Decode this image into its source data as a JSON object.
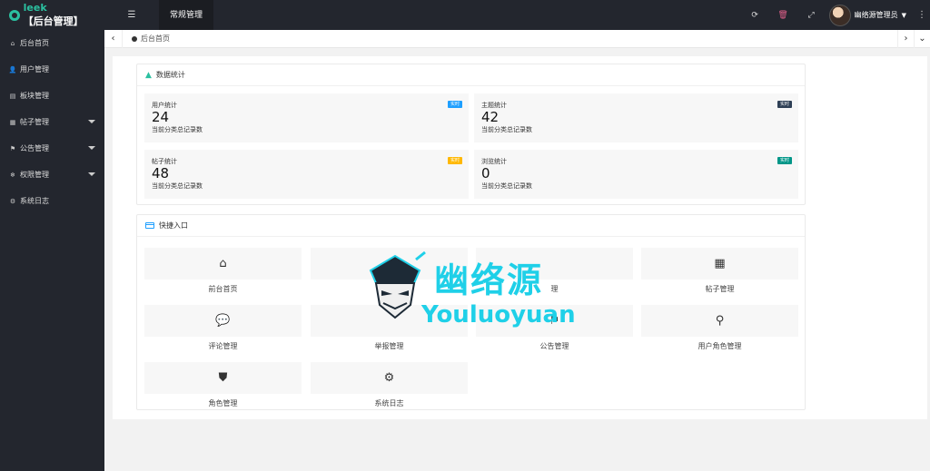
{
  "header": {
    "logo_text": "leek",
    "logo_sub": "【后台管理】",
    "tab": "常规管理",
    "user_name": "幽络源管理员"
  },
  "sidebar": {
    "items": [
      {
        "label": "后台首页",
        "icon": "home-icon",
        "has_arrow": false
      },
      {
        "label": "用户管理",
        "icon": "user-icon",
        "has_arrow": false
      },
      {
        "label": "板块管理",
        "icon": "file-icon",
        "has_arrow": false
      },
      {
        "label": "帖子管理",
        "icon": "calendar-icon",
        "has_arrow": true
      },
      {
        "label": "公告管理",
        "icon": "flag-icon",
        "has_arrow": true
      },
      {
        "label": "权限管理",
        "icon": "snowflake-icon",
        "has_arrow": true
      },
      {
        "label": "系统日志",
        "icon": "gears-icon",
        "has_arrow": false
      }
    ]
  },
  "tabs": {
    "home_label": "后台首页"
  },
  "stats_panel": {
    "title": "数据统计",
    "cards": [
      {
        "title": "用户统计",
        "value": "24",
        "sub": "当前分类总记录数",
        "badge": "实时",
        "badge_color": "#1e9fff"
      },
      {
        "title": "主题统计",
        "value": "42",
        "sub": "当前分类总记录数",
        "badge": "实时",
        "badge_color": "#2f4056"
      },
      {
        "title": "帖子统计",
        "value": "48",
        "sub": "当前分类总记录数",
        "badge": "实时",
        "badge_color": "#ffb800"
      },
      {
        "title": "浏览统计",
        "value": "0",
        "sub": "当前分类总记录数",
        "badge": "实时",
        "badge_color": "#009688"
      }
    ]
  },
  "quick_panel": {
    "title": "快捷入口",
    "items": [
      {
        "label": "前台首页",
        "icon": "home-icon"
      },
      {
        "label": "",
        "icon": ""
      },
      {
        "label": "理",
        "icon": ""
      },
      {
        "label": "帖子管理",
        "icon": "calendar-icon"
      },
      {
        "label": "评论管理",
        "icon": "comments-icon"
      },
      {
        "label": "举报管理",
        "icon": ""
      },
      {
        "label": "公告管理",
        "icon": "flag-icon"
      },
      {
        "label": "用户角色管理",
        "icon": "user-pin-icon"
      },
      {
        "label": "角色管理",
        "icon": "shield-icon"
      },
      {
        "label": "系统日志",
        "icon": "gears-icon"
      }
    ]
  },
  "watermark": {
    "cn": "幽络源",
    "en": "Youluoyuan"
  }
}
